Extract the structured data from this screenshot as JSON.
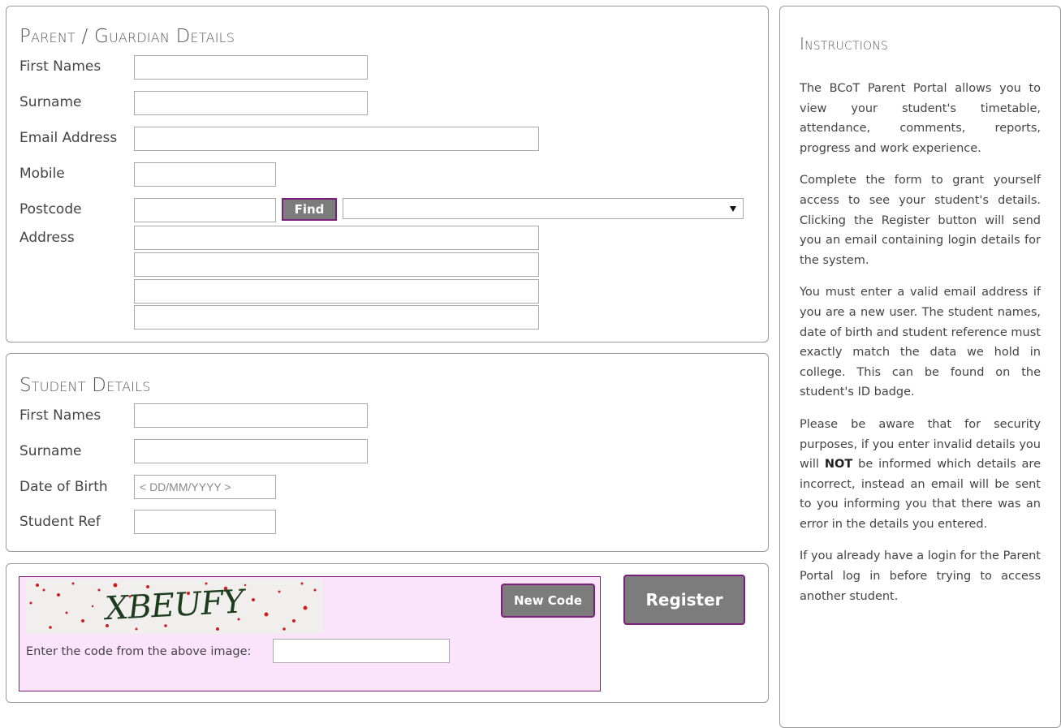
{
  "parent": {
    "heading": "Parent / Guardian Details",
    "first_names_label": "First Names",
    "surname_label": "Surname",
    "email_label": "Email Address",
    "mobile_label": "Mobile",
    "postcode_label": "Postcode",
    "find_button": "Find",
    "address_label": "Address",
    "address_select_value": ""
  },
  "student": {
    "heading": "Student Details",
    "first_names_label": "First Names",
    "surname_label": "Surname",
    "dob_label": "Date of Birth",
    "dob_placeholder": "< DD/MM/YYYY >",
    "ref_label": "Student Ref"
  },
  "captcha": {
    "image_text": "XBEUFY",
    "new_code_button": "New Code",
    "prompt": "Enter the code from the above image:"
  },
  "register_button": "Register",
  "instructions": {
    "heading": "Instructions",
    "p1": "The BCoT Parent Portal allows you to view your student's timetable, attendance, comments, reports, progress and work experience.",
    "p2": "Complete the form to grant yourself access to see your student's details. Clicking the Register button will send you an email containing login details for the system.",
    "p3": "You must enter a valid email address if you are a new user. The student names, date of birth and student reference must exactly match the data we hold in college. This can be found on the student's ID badge.",
    "p4_before": "Please be aware that for security purposes, if you enter invalid details you will",
    "p4_bold": "NOT",
    "p4_after": "be informed which details are incorrect, instead an email will be sent to you informing you that there was an error in the details you entered.",
    "p5": "If you already have a login for the Parent Portal log in before trying to access another student."
  },
  "colors": {
    "button_bg": "#7c7c7c",
    "button_border": "#7a1f7a",
    "captcha_bg": "#fbe3fb"
  }
}
